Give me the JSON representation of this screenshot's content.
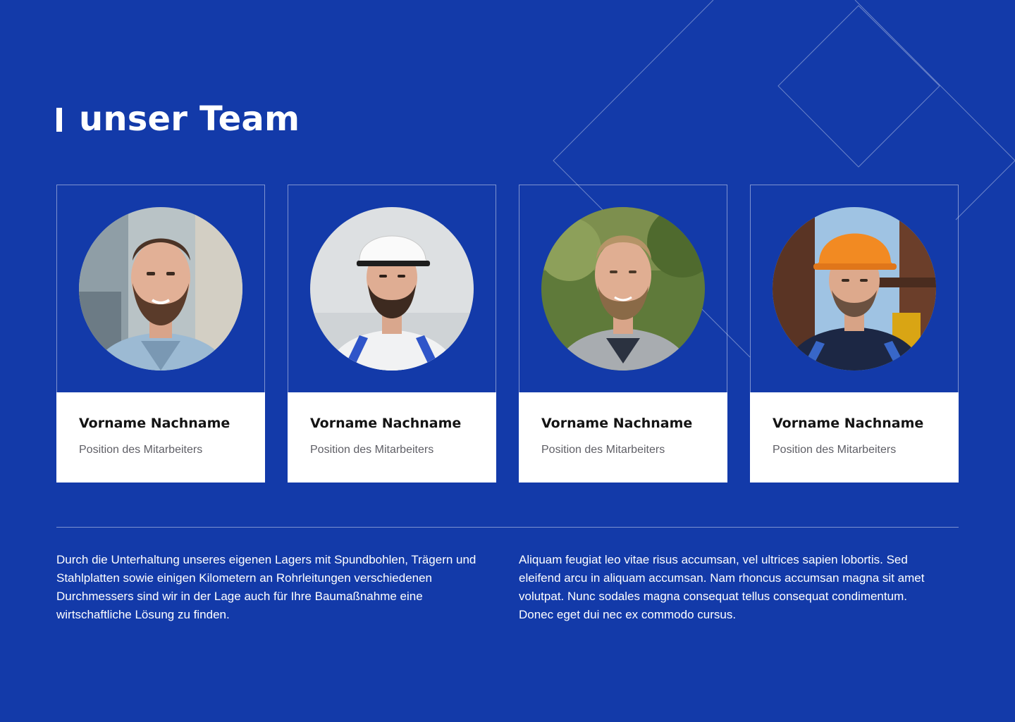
{
  "section": {
    "title": "unser Team"
  },
  "team": [
    {
      "name": "Vorname Nachname",
      "position": "Position des Mitarbeiters",
      "photo": "portrait-man-beard-hoodie"
    },
    {
      "name": "Vorname Nachname",
      "position": "Position des Mitarbeiters",
      "photo": "portrait-worker-white-helmet"
    },
    {
      "name": "Vorname Nachname",
      "position": "Position des Mitarbeiters",
      "photo": "portrait-man-gray-hoodie"
    },
    {
      "name": "Vorname Nachname",
      "position": "Position des Mitarbeiters",
      "photo": "portrait-worker-orange-helmet"
    }
  ],
  "body": {
    "left_text": "Durch die Unterhaltung unseres eigenen Lagers mit Spundbohlen, Trägern und Stahlplatten sowie einigen Kilometern an Rohrleitungen verschiedenen Durchmessers sind wir in der Lage auch für Ihre Baumaßnahme eine wirtschaftliche Lösung zu finden.",
    "right_text": "Aliquam feugiat leo vitae risus accumsan, vel ultrices sapien lobortis. Sed eleifend arcu in aliquam accumsan. Nam rhoncus accumsan magna sit amet volutpat. Nunc sodales magna consequat tellus consequat condimentum. Donec eget dui nec ex commodo cursus."
  },
  "colors": {
    "background": "#133aa9",
    "card_info_bg": "#ffffff",
    "name_text": "#141414",
    "position_text": "#5f5f66"
  }
}
